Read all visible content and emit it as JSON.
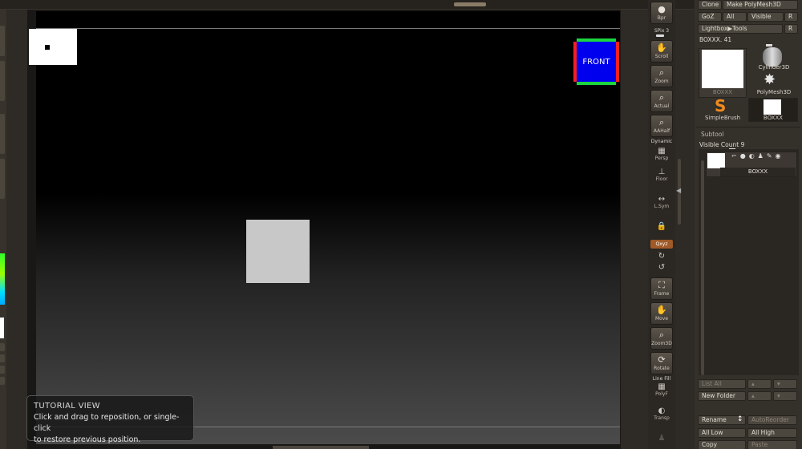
{
  "canvas": {
    "front_label": "FRONT",
    "tutorial": {
      "title": "TUTORIAL VIEW",
      "line1": "Click and drag to reposition, or single-click",
      "line2": "to restore previous position."
    }
  },
  "shelf": {
    "bpr": "Bpr",
    "spix_label": "SPix",
    "spix_value": "3",
    "scroll": "Scroll",
    "zoom": "Zoom",
    "actual": "Actual",
    "aahalf": "AAHalf",
    "dynamic": "Dynamic",
    "persp": "Persp",
    "floor": "Floor",
    "lsym": "L.Sym",
    "xyz": "Qxyz",
    "frame": "Frame",
    "move": "Move",
    "zoom3d": "Zoom3D",
    "rotate": "Rotate",
    "linefill": "Line Fill",
    "polyf": "PolyF",
    "transp": "Transp"
  },
  "tool": {
    "clone": "Clone",
    "make_polymesh": "Make PolyMesh3D",
    "goz": "GoZ",
    "all": "All",
    "visible": "Visible",
    "r": "R",
    "lightbox_tools": "Lightbox▶Tools",
    "current_tool_label": "BOXXX.",
    "current_tool_value": "41",
    "tools": [
      {
        "name": "BOXXX"
      },
      {
        "name": "Cylinder3D"
      },
      {
        "name": "PolyMesh3D"
      },
      {
        "name": "SimpleBrush"
      },
      {
        "name": "BOXXX"
      }
    ]
  },
  "subtool": {
    "header": "Subtool",
    "visible_count_label": "Visible Count",
    "visible_count": "9",
    "item_name": "BOXXX",
    "list_all": "List All",
    "new_folder": "New Folder",
    "rename": "Rename",
    "auto_reorder": "AutoReorder",
    "all_low": "All Low",
    "all_high": "All High",
    "copy": "Copy",
    "paste": "Paste"
  },
  "colors": {
    "accent_orange": "#a05a28",
    "front_blue": "#0000ee",
    "cube_green": "#1bd63f",
    "cube_red": "#ff1e1e"
  }
}
